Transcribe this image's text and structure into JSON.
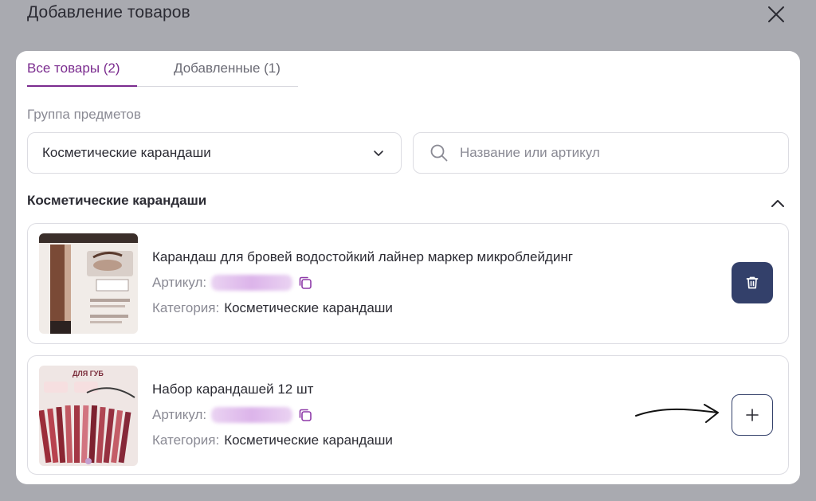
{
  "dialog": {
    "title": "Добавление товаров"
  },
  "tabs": [
    {
      "label": "Все товары (2)",
      "active": true
    },
    {
      "label": "Добавленные (1)",
      "active": false
    }
  ],
  "filters": {
    "group_label": "Группа предметов",
    "group_selected": "Косметические карандаши",
    "search_placeholder": "Название или артикул",
    "search_value": ""
  },
  "section": {
    "title": "Косметические карандаши",
    "expanded": true
  },
  "products": [
    {
      "title": "Карандаш для бровей водостойкий лайнер маркер микроблейдинг",
      "article_label": "Артикул:",
      "category_label": "Категория:",
      "category_value": "Косметические карандаши",
      "action": "delete",
      "thumb_icon": "brow-pencil-product-image"
    },
    {
      "title": "Набор карандашей 12 шт",
      "article_label": "Артикул:",
      "category_label": "Категория:",
      "category_value": "Косметические карандаши",
      "action": "add",
      "thumb_icon": "lip-pencils-set-product-image",
      "thumb_text": "ДЛЯ ГУБ"
    }
  ],
  "colors": {
    "accent": "#7b2c8f",
    "primary_button": "#33406a",
    "overlay": "#a9aab0"
  }
}
